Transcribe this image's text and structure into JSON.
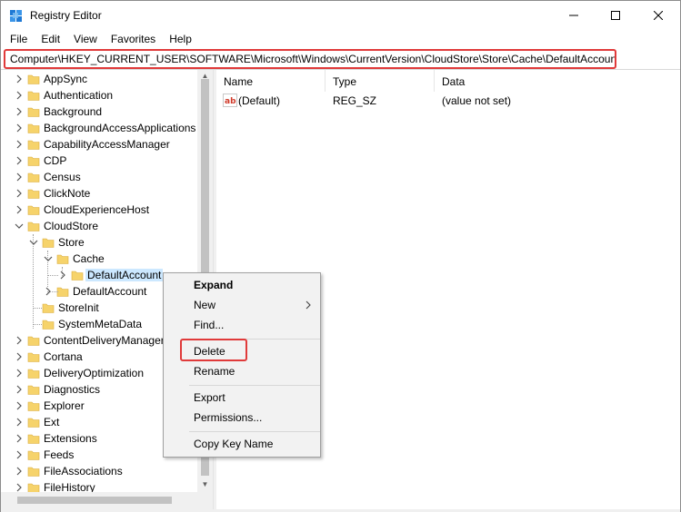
{
  "window": {
    "title": "Registry Editor"
  },
  "menu": [
    "File",
    "Edit",
    "View",
    "Favorites",
    "Help"
  ],
  "address": "Computer\\HKEY_CURRENT_USER\\SOFTWARE\\Microsoft\\Windows\\CurrentVersion\\CloudStore\\Store\\Cache\\DefaultAccount",
  "tree": [
    {
      "label": "AppSync",
      "level": 0,
      "expander": "collapsed"
    },
    {
      "label": "Authentication",
      "level": 0,
      "expander": "collapsed"
    },
    {
      "label": "Background",
      "level": 0,
      "expander": "collapsed"
    },
    {
      "label": "BackgroundAccessApplications",
      "level": 0,
      "expander": "collapsed"
    },
    {
      "label": "CapabilityAccessManager",
      "level": 0,
      "expander": "collapsed"
    },
    {
      "label": "CDP",
      "level": 0,
      "expander": "collapsed"
    },
    {
      "label": "Census",
      "level": 0,
      "expander": "collapsed"
    },
    {
      "label": "ClickNote",
      "level": 0,
      "expander": "collapsed"
    },
    {
      "label": "CloudExperienceHost",
      "level": 0,
      "expander": "collapsed"
    },
    {
      "label": "CloudStore",
      "level": 0,
      "expander": "expanded"
    },
    {
      "label": "Store",
      "level": 1,
      "expander": "expanded"
    },
    {
      "label": "Cache",
      "level": 2,
      "expander": "expanded"
    },
    {
      "label": "DefaultAccount",
      "level": 3,
      "expander": "collapsed",
      "selected": true
    },
    {
      "label": "DefaultAccount",
      "level": 2,
      "expander": "collapsed"
    },
    {
      "label": "StoreInit",
      "level": 1,
      "expander": "none"
    },
    {
      "label": "SystemMetaData",
      "level": 1,
      "expander": "none"
    },
    {
      "label": "ContentDeliveryManager",
      "level": 0,
      "expander": "collapsed"
    },
    {
      "label": "Cortana",
      "level": 0,
      "expander": "collapsed"
    },
    {
      "label": "DeliveryOptimization",
      "level": 0,
      "expander": "collapsed"
    },
    {
      "label": "Diagnostics",
      "level": 0,
      "expander": "collapsed"
    },
    {
      "label": "Explorer",
      "level": 0,
      "expander": "collapsed"
    },
    {
      "label": "Ext",
      "level": 0,
      "expander": "collapsed"
    },
    {
      "label": "Extensions",
      "level": 0,
      "expander": "collapsed"
    },
    {
      "label": "Feeds",
      "level": 0,
      "expander": "collapsed"
    },
    {
      "label": "FileAssociations",
      "level": 0,
      "expander": "collapsed"
    },
    {
      "label": "FileHistory",
      "level": 0,
      "expander": "collapsed"
    }
  ],
  "columns": {
    "name": "Name",
    "type": "Type",
    "data": "Data"
  },
  "values": [
    {
      "name": "(Default)",
      "type": "REG_SZ",
      "data": "(value not set)"
    }
  ],
  "context_menu": {
    "items": [
      {
        "label": "Expand",
        "bold": true
      },
      {
        "label": "New",
        "submenu": true
      },
      {
        "label": "Find..."
      },
      {
        "separator": true
      },
      {
        "label": "Delete",
        "highlight": true
      },
      {
        "label": "Rename"
      },
      {
        "separator": true
      },
      {
        "label": "Export"
      },
      {
        "label": "Permissions..."
      },
      {
        "separator": true
      },
      {
        "label": "Copy Key Name"
      }
    ]
  },
  "colors": {
    "highlight": "#e03a3a",
    "selection": "#cce8ff",
    "folder": "#f6d36b"
  }
}
